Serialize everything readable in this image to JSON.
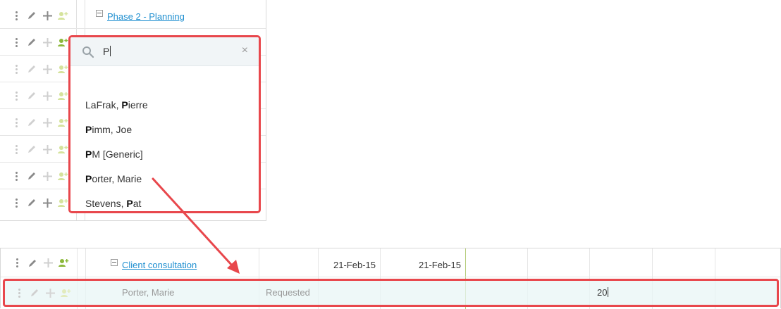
{
  "top_panel": {
    "phase_label": "Phase 2 - Planning"
  },
  "dropdown": {
    "query": "P",
    "close_symbol": "×",
    "items": [
      {
        "pre": "LaFrak, ",
        "match": "P",
        "post": "ierre"
      },
      {
        "pre": "",
        "match": "P",
        "post": "imm, Joe"
      },
      {
        "pre": "",
        "match": "P",
        "post": "M [Generic]"
      },
      {
        "pre": "",
        "match": "P",
        "post": "orter, Marie"
      },
      {
        "pre": "Stevens, ",
        "match": "P",
        "post": "at"
      }
    ]
  },
  "bottom_panel": {
    "task_label": "Client consultation",
    "start_date": "21-Feb-15",
    "end_date": "21-Feb-15",
    "assigned_name": "Porter, Marie",
    "assigned_status": "Requested",
    "hours_value": "20"
  },
  "colors": {
    "highlight_border": "#e8474c",
    "link": "#1f8fd0",
    "assign_icon": "#8cb83a"
  }
}
